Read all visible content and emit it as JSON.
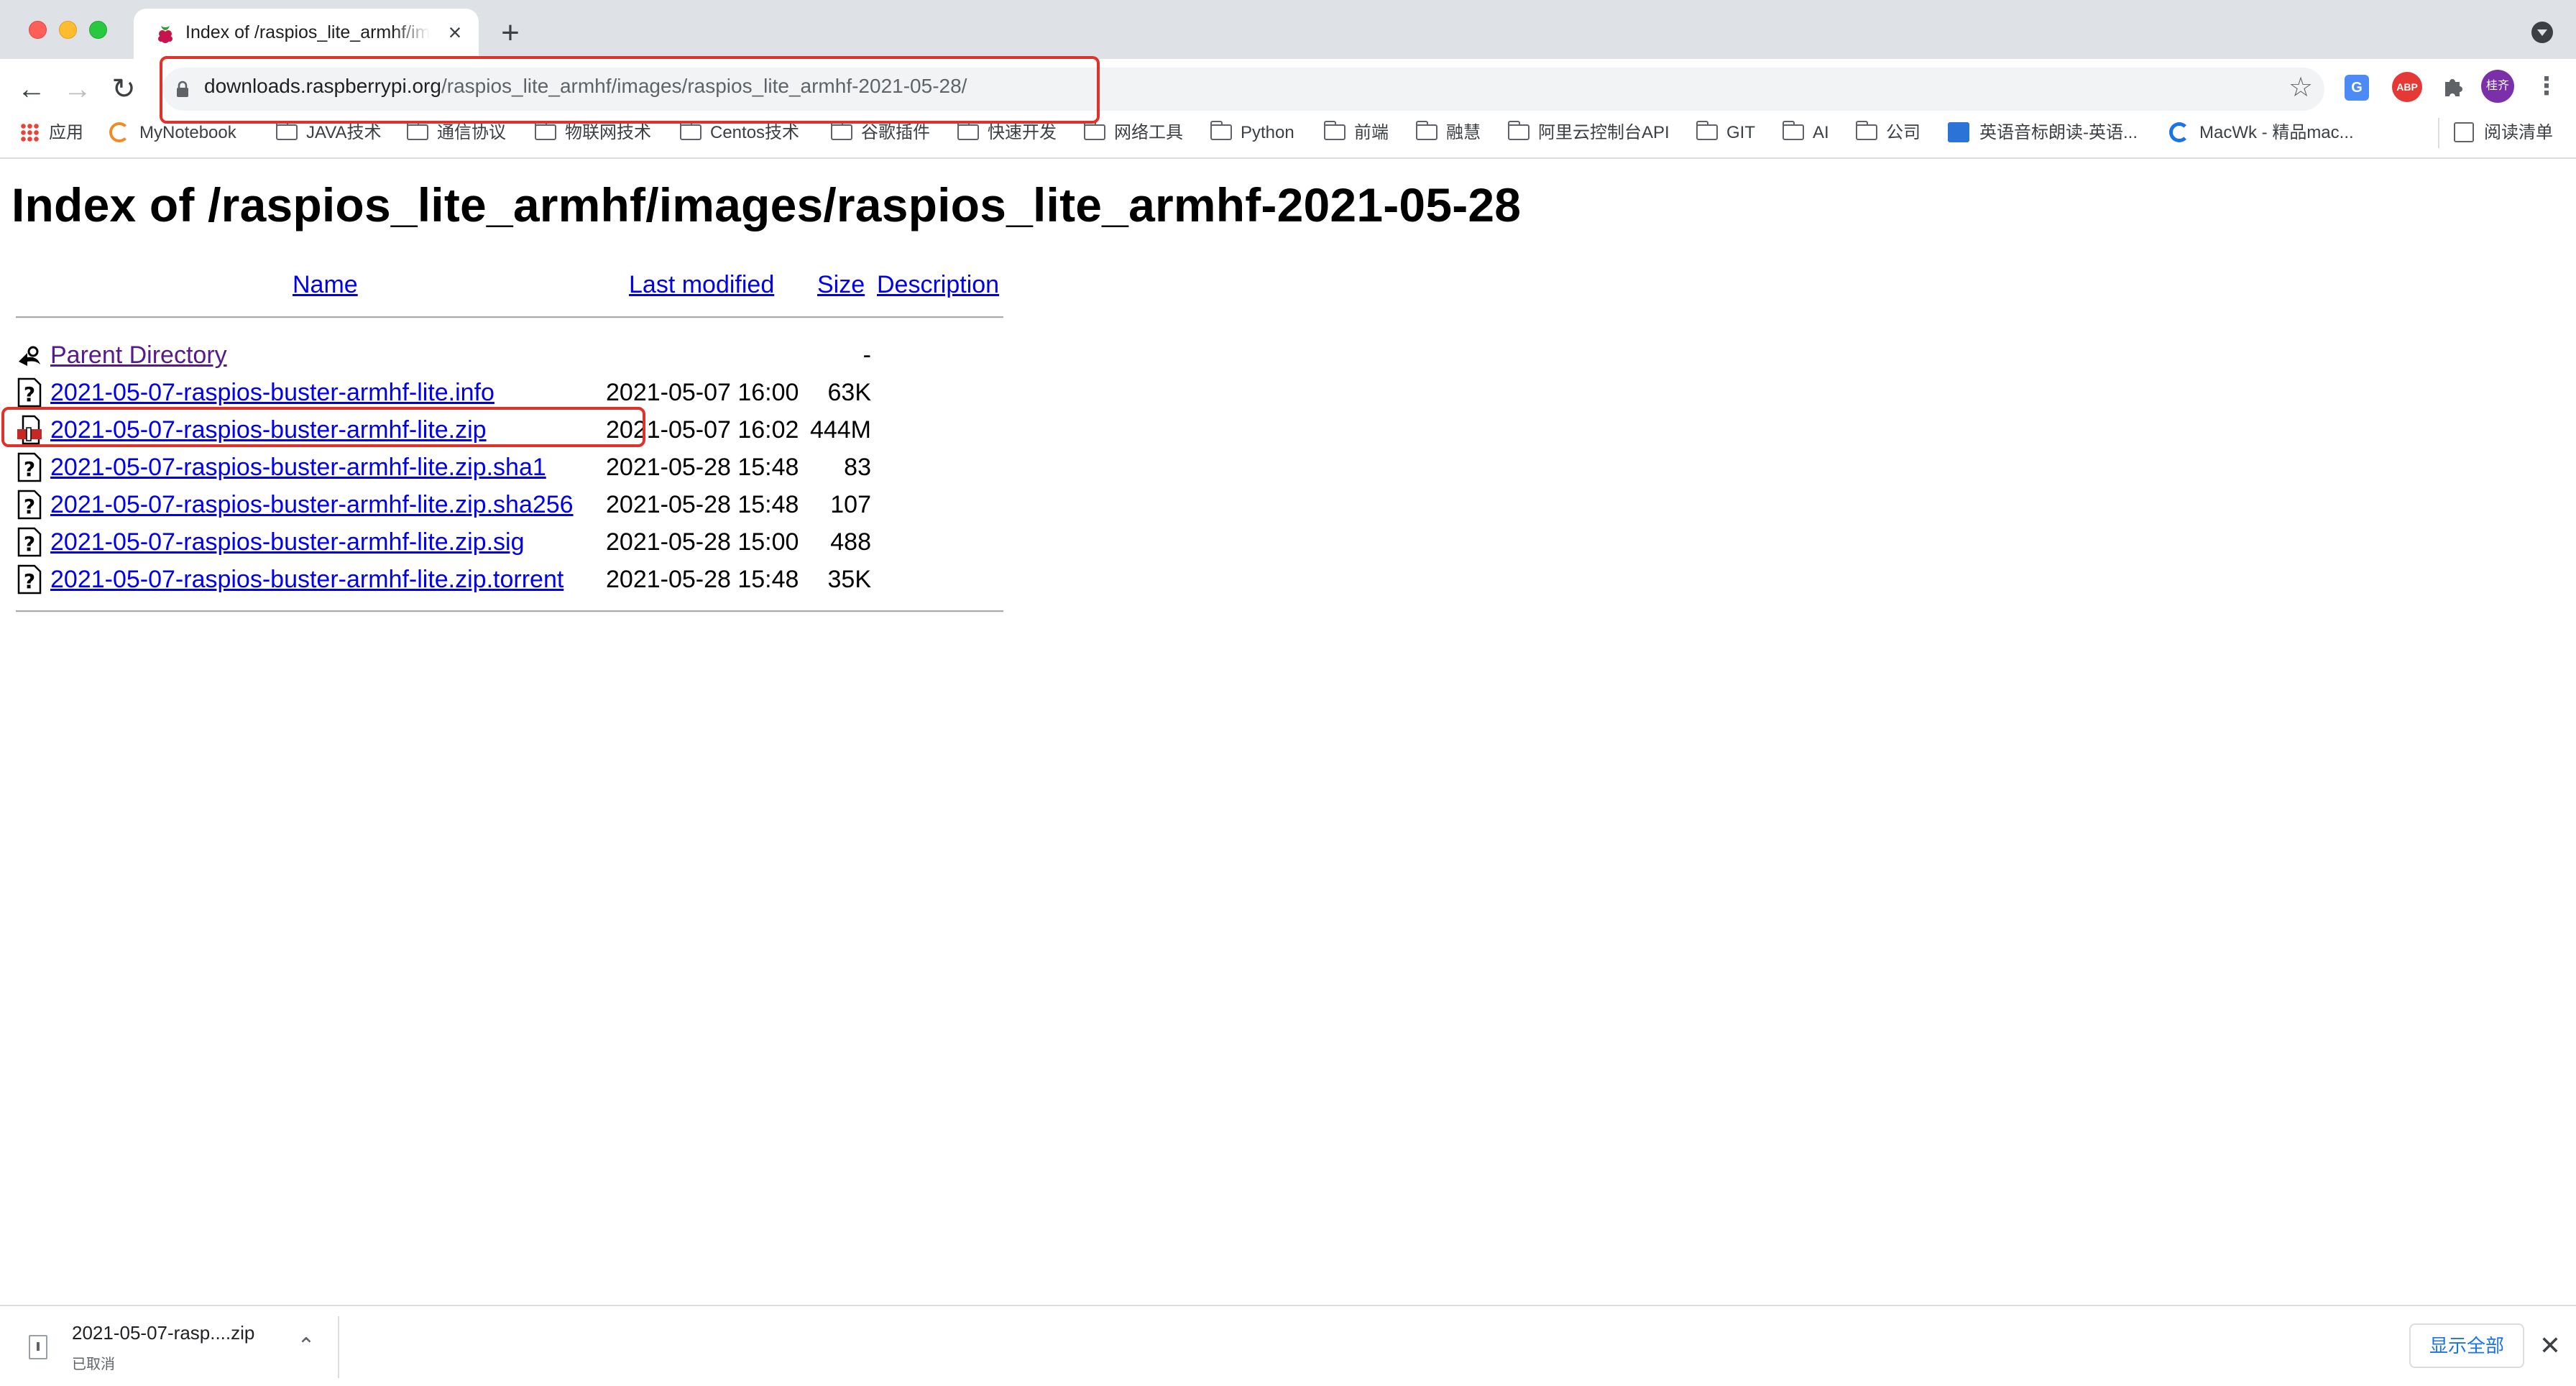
{
  "tab": {
    "title": "Index of /raspios_lite_armhf/images/raspios_lite_armhf-2021-05-28",
    "close_glyph": "×",
    "new_tab_glyph": "+"
  },
  "toolbar": {
    "back_glyph": "←",
    "forward_glyph": "→",
    "reload_glyph": "↻",
    "url_host": "downloads.raspberrypi.org",
    "url_path": "/raspios_lite_armhf/images/raspios_lite_armhf-2021-05-28/",
    "star_glyph": "☆",
    "avatar_label": "桂齐",
    "abp_label": "ABP",
    "translate_label": "G",
    "menu_glyph": "⋮"
  },
  "bookmarks": [
    {
      "label": "应用",
      "icon": "apps-icon"
    },
    {
      "label": "MyNotebook",
      "icon": "notebook-icon"
    },
    {
      "label": "JAVA技术",
      "icon": "folder-icon"
    },
    {
      "label": "通信协议",
      "icon": "folder-icon"
    },
    {
      "label": "物联网技术",
      "icon": "folder-icon"
    },
    {
      "label": "Centos技术",
      "icon": "folder-icon"
    },
    {
      "label": "谷歌插件",
      "icon": "folder-icon"
    },
    {
      "label": "快速开发",
      "icon": "folder-icon"
    },
    {
      "label": "网络工具",
      "icon": "folder-icon"
    },
    {
      "label": "Python",
      "icon": "folder-icon"
    },
    {
      "label": "前端",
      "icon": "folder-icon"
    },
    {
      "label": "融慧",
      "icon": "folder-icon"
    },
    {
      "label": "阿里云控制台API",
      "icon": "folder-icon"
    },
    {
      "label": "GIT",
      "icon": "folder-icon"
    },
    {
      "label": "AI",
      "icon": "folder-icon"
    },
    {
      "label": "公司",
      "icon": "folder-icon"
    },
    {
      "label": "英语音标朗读-英语...",
      "icon": "dict-icon"
    },
    {
      "label": "MacWk - 精品mac...",
      "icon": "macwk-icon"
    },
    {
      "label": "阅读清单",
      "icon": "reading-list-icon"
    }
  ],
  "page": {
    "heading": "Index of /raspios_lite_armhf/images/raspios_lite_armhf-2021-05-28",
    "columns": {
      "name": "Name",
      "last_modified": "Last modified",
      "size": "Size",
      "description": "Description"
    },
    "rows": [
      {
        "name": "Parent Directory",
        "date": "",
        "size": "-",
        "icon": "back-icon"
      },
      {
        "name": "2021-05-07-raspios-buster-armhf-lite.info",
        "date": "2021-05-07 16:00",
        "size": "63K",
        "icon": "unknown-file-icon"
      },
      {
        "name": "2021-05-07-raspios-buster-armhf-lite.zip",
        "date": "2021-05-07 16:02",
        "size": "444M",
        "icon": "archive-file-icon"
      },
      {
        "name": "2021-05-07-raspios-buster-armhf-lite.zip.sha1",
        "date": "2021-05-28 15:48",
        "size": "83",
        "icon": "unknown-file-icon"
      },
      {
        "name": "2021-05-07-raspios-buster-armhf-lite.zip.sha256",
        "date": "2021-05-28 15:48",
        "size": "107",
        "icon": "unknown-file-icon"
      },
      {
        "name": "2021-05-07-raspios-buster-armhf-lite.zip.sig",
        "date": "2021-05-28 15:00",
        "size": "488",
        "icon": "unknown-file-icon"
      },
      {
        "name": "2021-05-07-raspios-buster-armhf-lite.zip.torrent",
        "date": "2021-05-28 15:48",
        "size": "35K",
        "icon": "unknown-file-icon"
      }
    ]
  },
  "download_shelf": {
    "file_name": "2021-05-07-rasp....zip",
    "status": "已取消",
    "chevron_glyph": "⌃",
    "show_all_label": "显示全部",
    "close_glyph": "✕"
  },
  "colors": {
    "link": "#0000ee",
    "visited_link": "#551a8b",
    "annotation": "#e0312b",
    "tabstrip": "#dee1e6"
  }
}
